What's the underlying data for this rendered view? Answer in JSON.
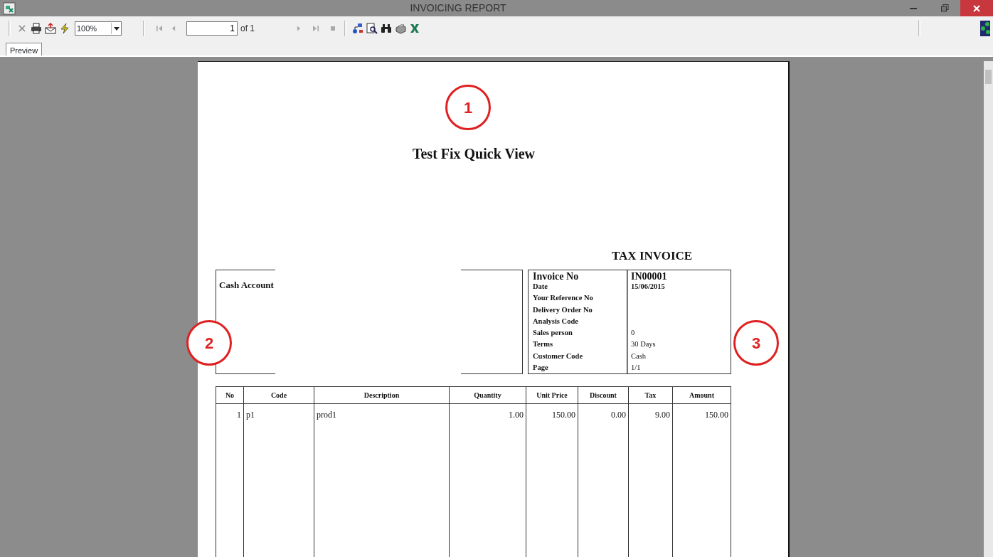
{
  "window": {
    "title": "INVOICING REPORT"
  },
  "toolbar": {
    "zoom": "100%",
    "page_input": "1",
    "page_total": "of 1",
    "nav_buttons": [
      {
        "kind": "first",
        "disabled": true
      },
      {
        "kind": "previous",
        "disabled": true
      },
      {
        "kind": "next",
        "disabled": true
      },
      {
        "kind": "last",
        "disabled": true
      },
      {
        "kind": "stop",
        "disabled": true
      }
    ]
  },
  "tabs": [
    {
      "label": "Preview",
      "selected": true
    }
  ],
  "report": {
    "title": "Test Fix Quick View",
    "doc_type": "TAX INVOICE",
    "customer": "Cash Account",
    "info": [
      {
        "label": "Invoice No",
        "value": "IN00001",
        "kind": "main"
      },
      {
        "label": "Date",
        "value": "15/06/2015",
        "kind": "date"
      },
      {
        "label": "Your Reference No",
        "kind": "field"
      },
      {
        "label": "Delivery Order No",
        "kind": "field"
      },
      {
        "label": "Analysis Code",
        "kind": "field"
      },
      {
        "label": "Sales person",
        "value": "0",
        "kind": "field"
      },
      {
        "label": "Terms",
        "value": "30 Days",
        "kind": "field"
      },
      {
        "label": "Customer Code",
        "value": "Cash",
        "kind": "field"
      },
      {
        "label": "Page",
        "value": "1/1",
        "kind": "field"
      }
    ],
    "table": {
      "columns": [
        "No",
        "Code",
        "Description",
        "Quantity",
        "Unit Price",
        "Discount",
        "Tax",
        "Amount"
      ],
      "rows": [
        [
          "1",
          "p1",
          "prod1",
          "1.00",
          "150.00",
          "0.00",
          "9.00",
          "150.00"
        ]
      ]
    }
  },
  "callouts": [
    {
      "label": "1"
    },
    {
      "label": "2"
    },
    {
      "label": "3"
    }
  ]
}
